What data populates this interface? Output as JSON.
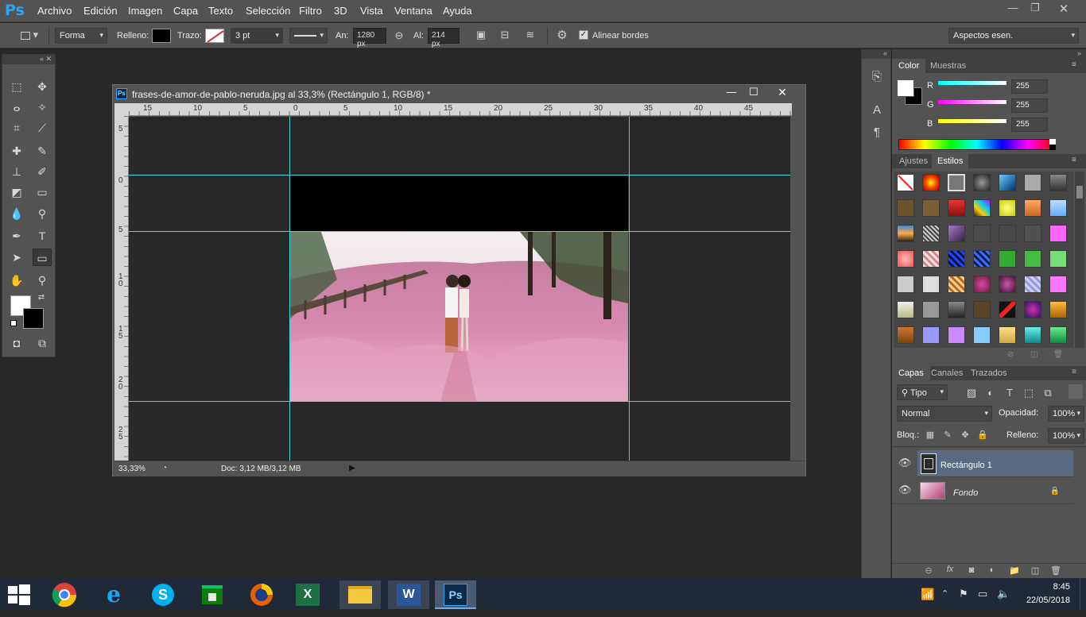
{
  "menubar": {
    "logo": "Ps",
    "items": [
      "Archivo",
      "Edición",
      "Imagen",
      "Capa",
      "Texto",
      "Selección",
      "Filtro",
      "3D",
      "Vista",
      "Ventana",
      "Ayuda"
    ]
  },
  "options": {
    "mode": "Forma",
    "fill_label": "Relleno:",
    "stroke_label": "Trazo:",
    "stroke_width": "3 pt",
    "width_label": "An:",
    "width_value": "1280 px",
    "height_label": "Al:",
    "height_value": "214 px",
    "align_edges": "Alinear bordes",
    "workspace": "Aspectos esen."
  },
  "document": {
    "title": "frases-de-amor-de-pablo-neruda.jpg al 33,3% (Rectángulo 1, RGB/8) *",
    "ruler_h": [
      "15",
      "10",
      "5",
      "0",
      "5",
      "10",
      "15",
      "20",
      "25",
      "30",
      "35",
      "40",
      "45"
    ],
    "ruler_v": [
      "5",
      "0",
      "5",
      "1\n0",
      "1\n5",
      "2\n0",
      "2\n5"
    ],
    "zoom": "33,33%",
    "doc_info": "Doc: 3,12 MB/3,12 MB"
  },
  "color_panel": {
    "tabs": [
      "Color",
      "Muestras"
    ],
    "r_label": "R",
    "r_value": "255",
    "g_label": "G",
    "g_value": "255",
    "b_label": "B",
    "b_value": "255"
  },
  "styles_panel": {
    "tabs": [
      "Ajustes",
      "Estilos"
    ]
  },
  "layers_panel": {
    "tabs": [
      "Capas",
      "Canales",
      "Trazados"
    ],
    "filter": "Tipo",
    "blend_mode": "Normal",
    "opacity_label": "Opacidad:",
    "opacity_value": "100%",
    "lock_label": "Bloq.:",
    "fill_label": "Relleno:",
    "fill_value": "100%",
    "layers": [
      {
        "name": "Rectángulo 1"
      },
      {
        "name": "Fondo"
      }
    ]
  },
  "taskbar": {
    "time": "8:45",
    "date": "22/05/2018"
  },
  "colors": {
    "guide": "#40d8e4",
    "ps_blue": "#2fa3f6",
    "panel_bg": "#535353",
    "canvas_bg": "#282828"
  }
}
